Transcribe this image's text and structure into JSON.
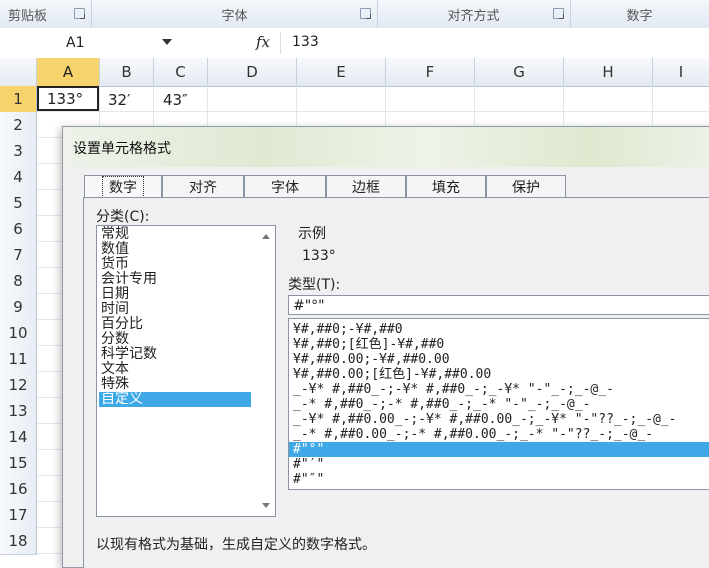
{
  "ribbon": {
    "groups": [
      "剪贴板",
      "字体",
      "对齐方式",
      "数字"
    ]
  },
  "formula_bar": {
    "name_box": "A1",
    "fx_label": "fx",
    "value": "133"
  },
  "sheet": {
    "columns": [
      "A",
      "B",
      "C",
      "D",
      "E",
      "F",
      "G",
      "H",
      "I"
    ],
    "rows": [
      "1",
      "2",
      "3",
      "4",
      "5",
      "6",
      "7",
      "8",
      "9",
      "10",
      "11",
      "12",
      "13",
      "14",
      "15",
      "16",
      "17",
      "18"
    ],
    "cells": {
      "A1": "133°",
      "B1": "32′",
      "C1": "43″"
    }
  },
  "dialog": {
    "title": "设置单元格格式",
    "tabs": [
      "数字",
      "对齐",
      "字体",
      "边框",
      "填充",
      "保护"
    ],
    "active_tab": "数字",
    "category_label": "分类(C):",
    "categories": [
      "常规",
      "数值",
      "货币",
      "会计专用",
      "日期",
      "时间",
      "百分比",
      "分数",
      "科学记数",
      "文本",
      "特殊",
      "自定义"
    ],
    "selected_category": "自定义",
    "sample_label": "示例",
    "sample_value": "133°",
    "type_label": "类型(T):",
    "type_value": "#\"°\"",
    "formats": [
      "¥#,##0;-¥#,##0",
      "¥#,##0;[红色]-¥#,##0",
      "¥#,##0.00;-¥#,##0.00",
      "¥#,##0.00;[红色]-¥#,##0.00",
      "_-¥* #,##0_-;-¥* #,##0_-;_-¥* \"-\"_-;_-@_-",
      "_-* #,##0_-;-* #,##0_-;_-* \"-\"_-;_-@_-",
      "_-¥* #,##0.00_-;-¥* #,##0.00_-;_-¥* \"-\"??_-;_-@_-",
      "_-* #,##0.00_-;-* #,##0.00_-;_-* \"-\"??_-;_-@_-",
      "#\"°\"",
      "#\"′\"",
      "#\"″\""
    ],
    "selected_format_index": 8,
    "hint": "以现有格式为基础，生成自定义的数字格式。"
  },
  "colors": {
    "selection_blue": "#3fa9e8",
    "header_highlight": "#f7d36b"
  }
}
